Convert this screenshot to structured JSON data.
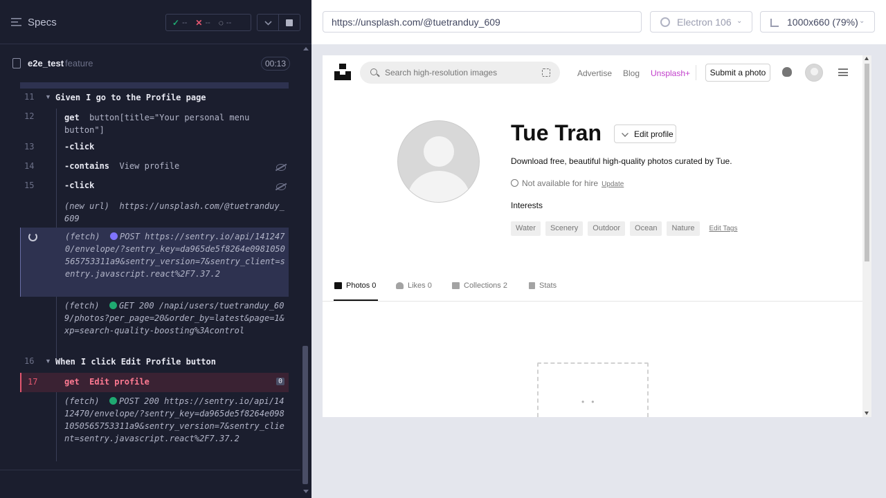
{
  "runner": {
    "specs_label": "Specs",
    "status": {
      "passed": "--",
      "failed": "--",
      "pending": "--"
    },
    "file": {
      "name": "e2e_test",
      "ext": "feature"
    },
    "timer": "00:13",
    "log": {
      "step11": {
        "num": "11",
        "keyword": "Given",
        "text": "I go to the Profile page"
      },
      "step12": {
        "num": "12",
        "cmd": "get",
        "arg": "button[title=\"Your personal menu button\"]"
      },
      "step13": {
        "num": "13",
        "cmd": "-click"
      },
      "step14": {
        "num": "14",
        "cmd": "-contains",
        "arg": "View profile"
      },
      "step15": {
        "num": "15",
        "cmd": "-click"
      },
      "newurl": {
        "label": "(new url)",
        "url": "https://unsplash.com/@tuetranduy_609"
      },
      "fetch1": {
        "label": "(fetch)",
        "method": "POST",
        "url": "https://sentry.io/api/1412470/envelope/?sentry_key=da965de5f8264e0981050565753311a9&sentry_version=7&sentry_client=sentry.javascript.react%2F7.37.2"
      },
      "fetch2": {
        "label": "(fetch)",
        "method": "GET 200",
        "url": "/napi/users/tuetranduy_609/photos?per_page=20&order_by=latest&page=1&xp=search-quality-boosting%3Acontrol"
      },
      "step16": {
        "num": "16",
        "keyword": "When",
        "text": "I click Edit Profile button"
      },
      "step17": {
        "num": "17",
        "cmd": "get",
        "arg": "Edit profile",
        "count": "0"
      },
      "fetch3": {
        "label": "(fetch)",
        "method": "POST 200",
        "url": "https://sentry.io/api/1412470/envelope/?sentry_key=da965de5f8264e0981050565753311a9&sentry_version=7&sentry_client=sentry.javascript.react%2F7.37.2"
      }
    }
  },
  "browser_bar": {
    "url": "https://unsplash.com/@tuetranduy_609",
    "browser": "Electron 106",
    "viewport": "1000x660  (79%)"
  },
  "unsplash": {
    "search_placeholder": "Search high-resolution images",
    "nav": {
      "advertise": "Advertise",
      "blog": "Blog",
      "plus": "Unsplash+"
    },
    "submit": "Submit a photo",
    "profile": {
      "name": "Tue Tran",
      "edit": "Edit profile",
      "bio": "Download free, beautiful high-quality photos curated by Tue.",
      "hire": "Not available for hire",
      "update": "Update",
      "interests_label": "Interests",
      "tags": [
        "Water",
        "Scenery",
        "Outdoor",
        "Ocean",
        "Nature"
      ],
      "edit_tags": "Edit Tags"
    },
    "tabs": {
      "photos": "Photos 0",
      "likes": "Likes 0",
      "collections": "Collections 2",
      "stats": "Stats"
    }
  },
  "colors": {
    "runner_bg": "#1b1e2e",
    "active_row": "#2e3250",
    "fail_row": "#3a2233",
    "fail_accent": "#e45770",
    "plus_accent": "#c13ecb",
    "xhr_green": "#1fa971",
    "fetch_purple": "#7f74ff"
  }
}
